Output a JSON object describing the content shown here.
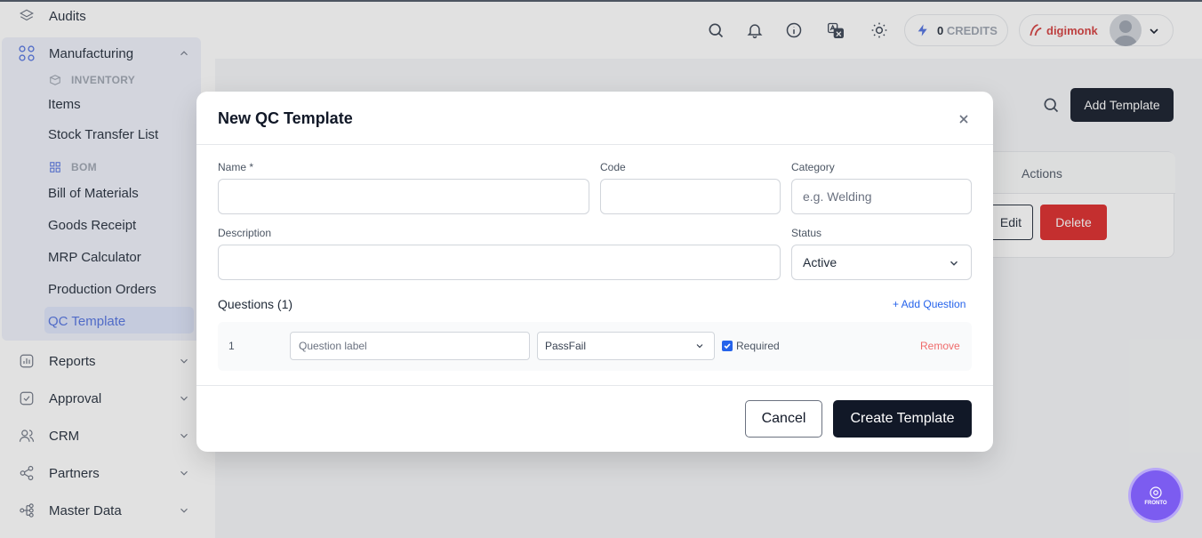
{
  "sidebar": {
    "top_item": "Audits",
    "manufacturing": {
      "label": "Manufacturing",
      "inventory_heading": "INVENTORY",
      "inventory_items": [
        "Items",
        "Stock Transfer List"
      ],
      "bom_heading": "BOM",
      "bom_items": [
        "Bill of Materials",
        "Goods Receipt",
        "MRP Calculator",
        "Production Orders",
        "QC Template"
      ],
      "active_item": "QC Template"
    },
    "sections": [
      "Reports",
      "Approval",
      "CRM",
      "Partners",
      "Master Data"
    ]
  },
  "topbar": {
    "credits_count": "0",
    "credits_label": "CREDITS",
    "brand_name": "digimonk",
    "icons": [
      "search-icon",
      "bell-icon",
      "info-icon",
      "translate-icon",
      "sun-icon",
      "lightning-icon",
      "chevron-down-icon"
    ]
  },
  "page": {
    "add_template_label": "Add Template",
    "table_actions_header": "Actions",
    "edit_label": "Edit",
    "delete_label": "Delete"
  },
  "modal": {
    "title": "New QC Template",
    "fields": {
      "name_label": "Name *",
      "name_value": "",
      "code_label": "Code",
      "code_value": "",
      "category_label": "Category",
      "category_placeholder": "e.g. Welding",
      "description_label": "Description",
      "description_value": "",
      "status_label": "Status",
      "status_value": "Active"
    },
    "questions": {
      "heading": "Questions (1)",
      "add_label": "+ Add Question",
      "rows": [
        {
          "number": "1",
          "label_placeholder": "Question label",
          "type": "PassFail",
          "required_label": "Required",
          "required_checked": true,
          "remove_label": "Remove"
        }
      ]
    },
    "cancel_label": "Cancel",
    "create_label": "Create Template"
  },
  "fab": {
    "label": "FRONTO"
  },
  "colors": {
    "primary_dark": "#111827",
    "accent_blue": "#2563eb",
    "danger": "#dc2626",
    "fab_purple": "#7c5cf0",
    "sidebar_active_bg": "#dde4fb"
  }
}
